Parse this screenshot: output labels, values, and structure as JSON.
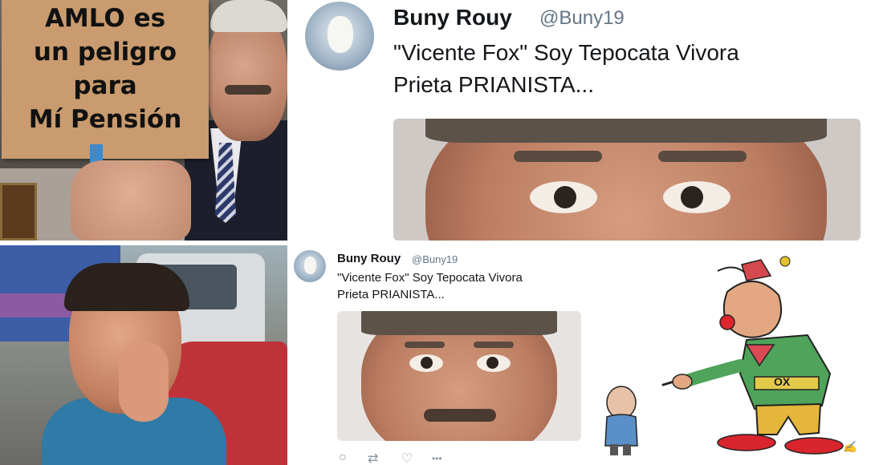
{
  "meme_sign": {
    "line1": "AMLO es",
    "line2": "un peligro",
    "line3": "para",
    "line4": "Mí Pensión"
  },
  "tweet_large": {
    "name": "Buny Rouy",
    "handle": "@Buny19",
    "line1": "\"Vicente Fox\" Soy Tepocata Vivora",
    "line2": "Prieta PRIANISTA..."
  },
  "tweet_small": {
    "name": "Buny Rouy",
    "handle": "@Buny19",
    "line1": "\"Vicente Fox\" Soy Tepocata Vivora",
    "line2": "Prieta PRIANISTA...",
    "actions": {
      "reply": "○",
      "retweet": "⇄",
      "like": "♡",
      "more": "•••"
    }
  },
  "cartoon": {
    "shirt_label": "OX"
  }
}
